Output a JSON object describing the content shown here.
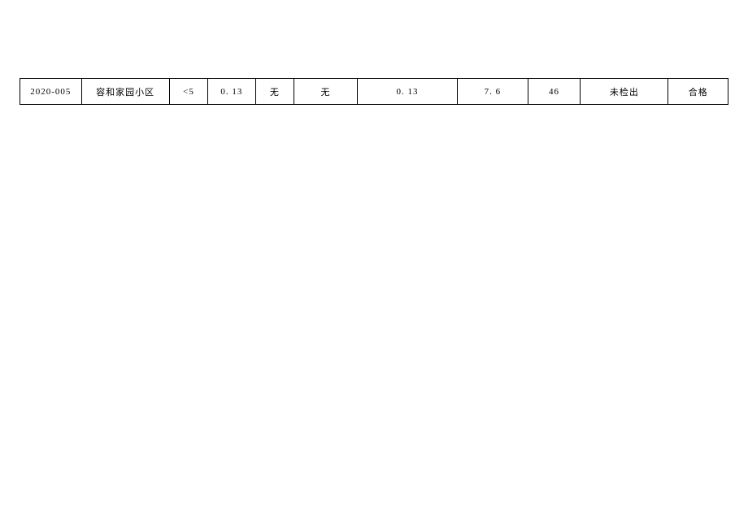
{
  "row": {
    "c0": "2020-005",
    "c1": "容和家园小区",
    "c2": "<5",
    "c3": "0. 13",
    "c4": "无",
    "c5": "无",
    "c6": "0. 13",
    "c7": "7. 6",
    "c8": "46",
    "c9": "未检出",
    "c10": "合格"
  }
}
